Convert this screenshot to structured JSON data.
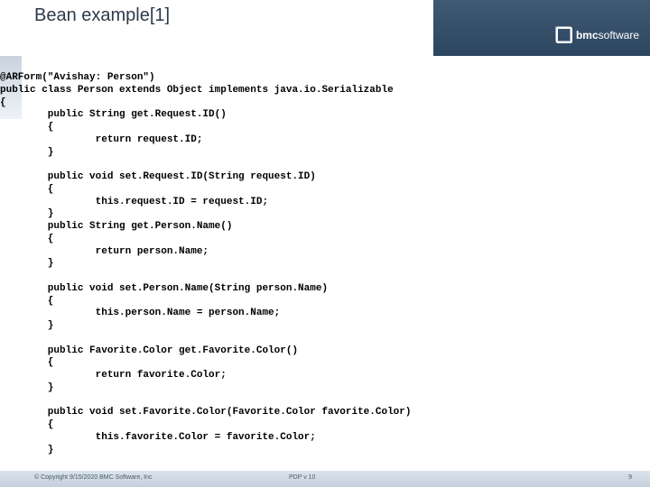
{
  "header": {
    "title": "Bean example[1]"
  },
  "logo": {
    "brand_bold": "bmc",
    "brand_rest": "software"
  },
  "code": {
    "lines": [
      "@ARForm(\"Avishay: Person\")",
      "public class Person extends Object implements java.io.Serializable",
      "{",
      "        public String get.Request.ID()",
      "        {",
      "                return request.ID;",
      "        }",
      "",
      "        public void set.Request.ID(String request.ID)",
      "        {",
      "                this.request.ID = request.ID;",
      "        }",
      "        public String get.Person.Name()",
      "        {",
      "                return person.Name;",
      "        }",
      "",
      "        public void set.Person.Name(String person.Name)",
      "        {",
      "                this.person.Name = person.Name;",
      "        }",
      "",
      "        public Favorite.Color get.Favorite.Color()",
      "        {",
      "                return favorite.Color;",
      "        }",
      "",
      "        public void set.Favorite.Color(Favorite.Color favorite.Color)",
      "        {",
      "                this.favorite.Color = favorite.Color;",
      "        }"
    ]
  },
  "footer": {
    "copyright": "© Copyright 9/15/2020 BMC Software, Inc",
    "middle": "PDP v 10",
    "page": "9"
  }
}
